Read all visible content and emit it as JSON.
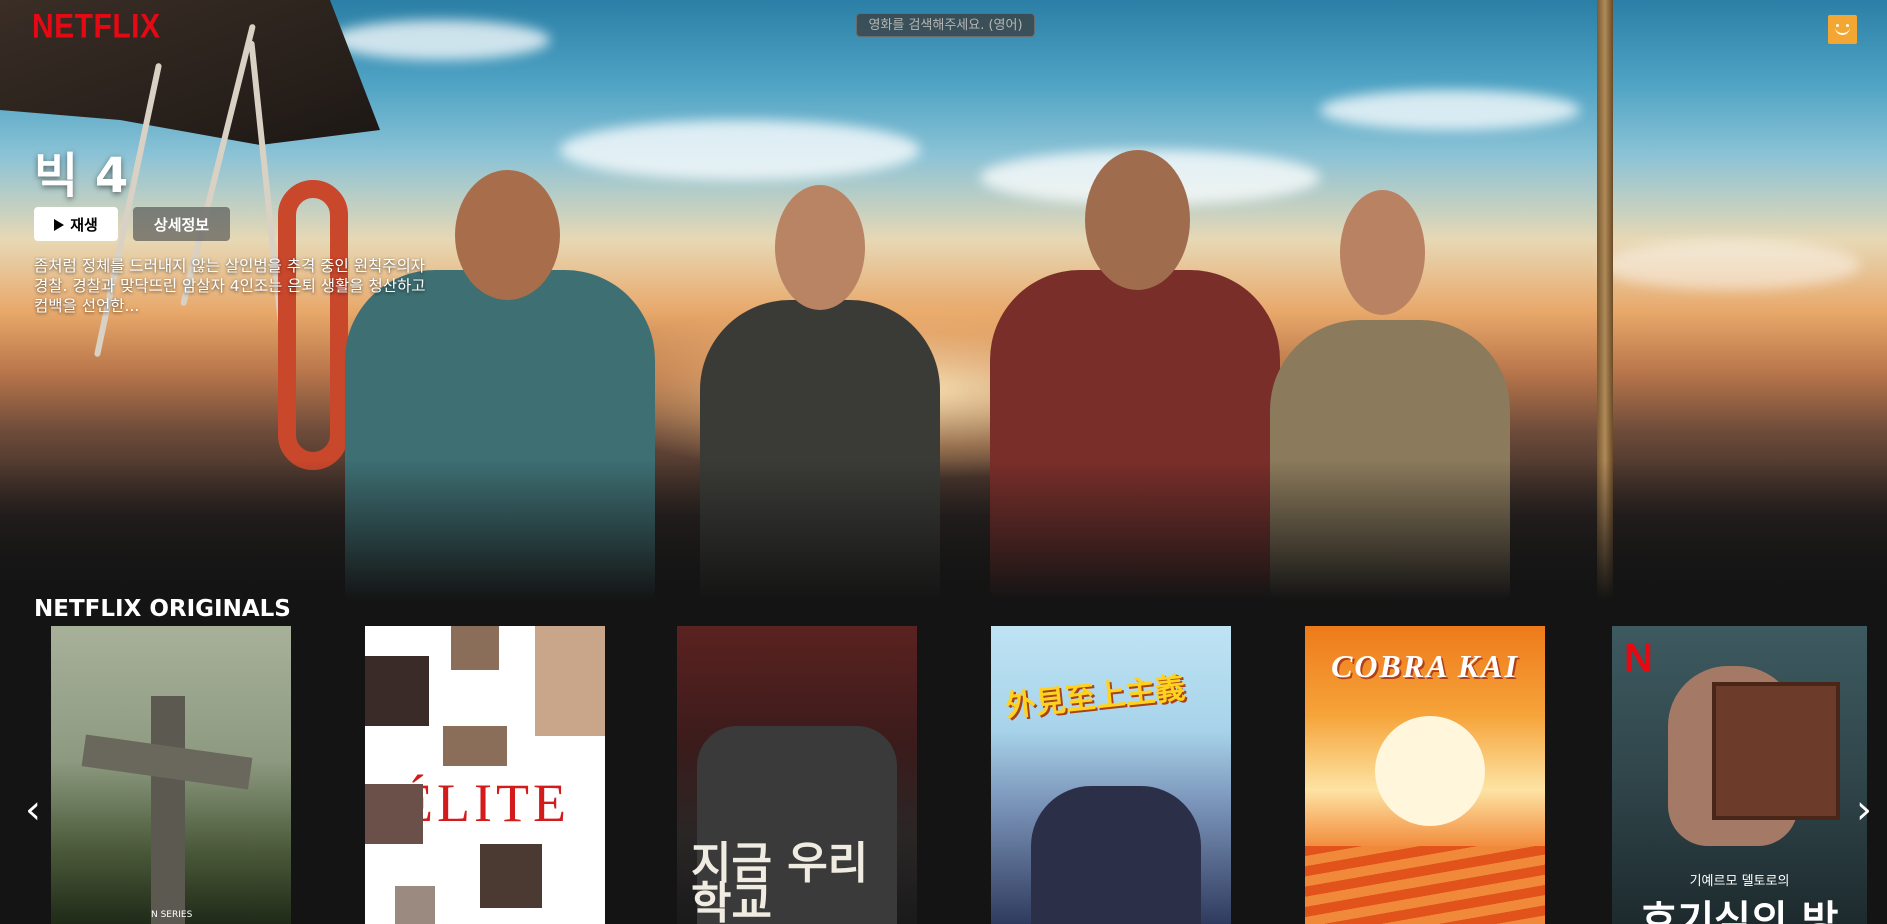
{
  "brand": {
    "logo_text": "NETFLIX",
    "color": "#e50914"
  },
  "search": {
    "placeholder": "영화를 검색해주세요. (영어)"
  },
  "profile": {
    "icon": "smiley-avatar-icon",
    "color": "#f3a732"
  },
  "hero": {
    "title": "빅 4",
    "play_label": "재생",
    "info_label": "상세정보",
    "description": "좀처럼 정체를 드러내지 않는 살인범을 추격 중인 원칙주의자 경찰. 경찰과 맞닥뜨린 암살자 4인조는 은퇴 생활을 청산하고 컴백을 선언한..."
  },
  "row": {
    "title": "NETFLIX ORIGINALS",
    "posters": [
      {
        "name": "cross-poster",
        "text": "N SERIES"
      },
      {
        "name": "elite-poster",
        "text": "ÉLITE"
      },
      {
        "name": "all-of-us-are-dead-poster",
        "text": "지금 우리 학교"
      },
      {
        "name": "lookism-poster",
        "text": "外見至上主義"
      },
      {
        "name": "cobra-kai-poster",
        "text": "COBRA KAI"
      },
      {
        "name": "cabinet-of-curiosities-poster",
        "subtitle": "기예르모 델토로의",
        "text": "호기심의 방"
      }
    ],
    "prev_icon": "chevron-left-icon",
    "next_icon": "chevron-right-icon"
  }
}
